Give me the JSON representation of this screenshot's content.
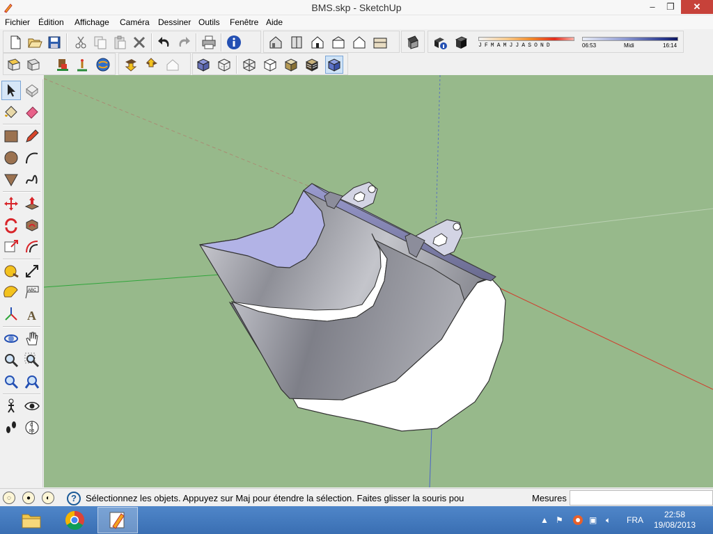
{
  "window": {
    "title": "BMS.skp - SketchUp",
    "minimize": "‒",
    "maximize": "❐",
    "close": "✕"
  },
  "menu": [
    "Fichier",
    "Édition",
    "Affichage",
    "Caméra",
    "Dessiner",
    "Outils",
    "Fenêtre",
    "Aide"
  ],
  "shadow_panel": {
    "months": "JFMAMJJASOND",
    "time_start": "06:53",
    "time_mid": "Midi",
    "time_end": "16:14"
  },
  "statusbar": {
    "message": "Sélectionnez les objets. Appuyez sur Maj pour étendre la sélection. Faites glisser la souris pou",
    "measures_label": "Mesures",
    "measures_value": ""
  },
  "taskbar": {
    "language": "FRA",
    "time": "22:58",
    "date": "19/08/2013"
  },
  "colors": {
    "viewport_bg": "#97b98b",
    "axis_red": "#d23b2b",
    "axis_green": "#2fa53a",
    "axis_blue": "#4a63c9",
    "taskbar": "#3a6fb3"
  }
}
